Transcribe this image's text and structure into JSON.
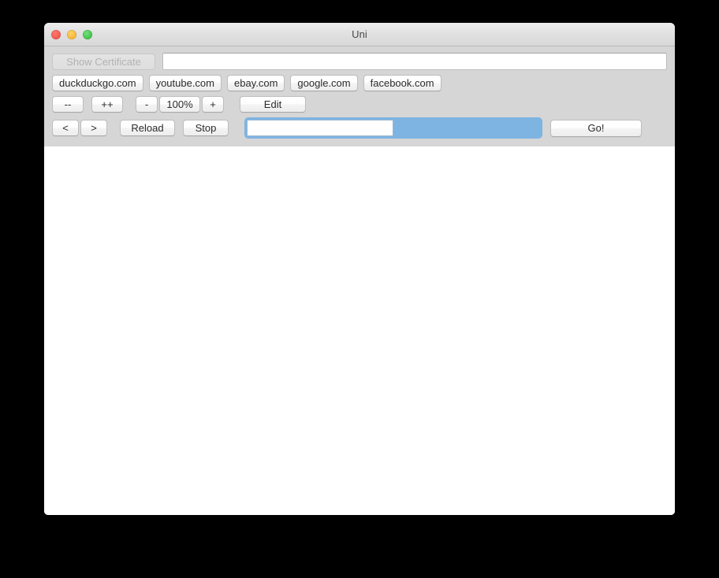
{
  "window": {
    "title": "Uni",
    "traffic_lights": [
      {
        "name": "close",
        "color": "#f1564e"
      },
      {
        "name": "minimize",
        "color": "#f5b632"
      },
      {
        "name": "maximize",
        "color": "#3fc14b"
      }
    ]
  },
  "toolbar": {
    "certificate": {
      "button_label": "Show Certificate",
      "button_enabled": false,
      "field_value": "",
      "field_placeholder": ""
    },
    "bookmarks": [
      {
        "label": "duckduckgo.com"
      },
      {
        "label": "youtube.com"
      },
      {
        "label": "ebay.com"
      },
      {
        "label": "google.com"
      },
      {
        "label": "facebook.com"
      }
    ],
    "zoom_row": {
      "decrease_all_label": "--",
      "increase_all_label": "++",
      "zoom_out_label": "-",
      "zoom_level_label": "100%",
      "zoom_in_label": "+",
      "edit_label": "Edit"
    },
    "navigation": {
      "back_label": "<",
      "forward_label": ">",
      "reload_label": "Reload",
      "stop_label": "Stop",
      "url_value": "",
      "url_placeholder": "",
      "go_label": "Go!"
    }
  },
  "colors": {
    "toolbar_bg": "#d6d6d6",
    "titlebar_bg": "#e4e4e4",
    "focus_ring": "#7eb4e2",
    "content_bg": "#ffffff",
    "desktop_bg": "#000000"
  }
}
